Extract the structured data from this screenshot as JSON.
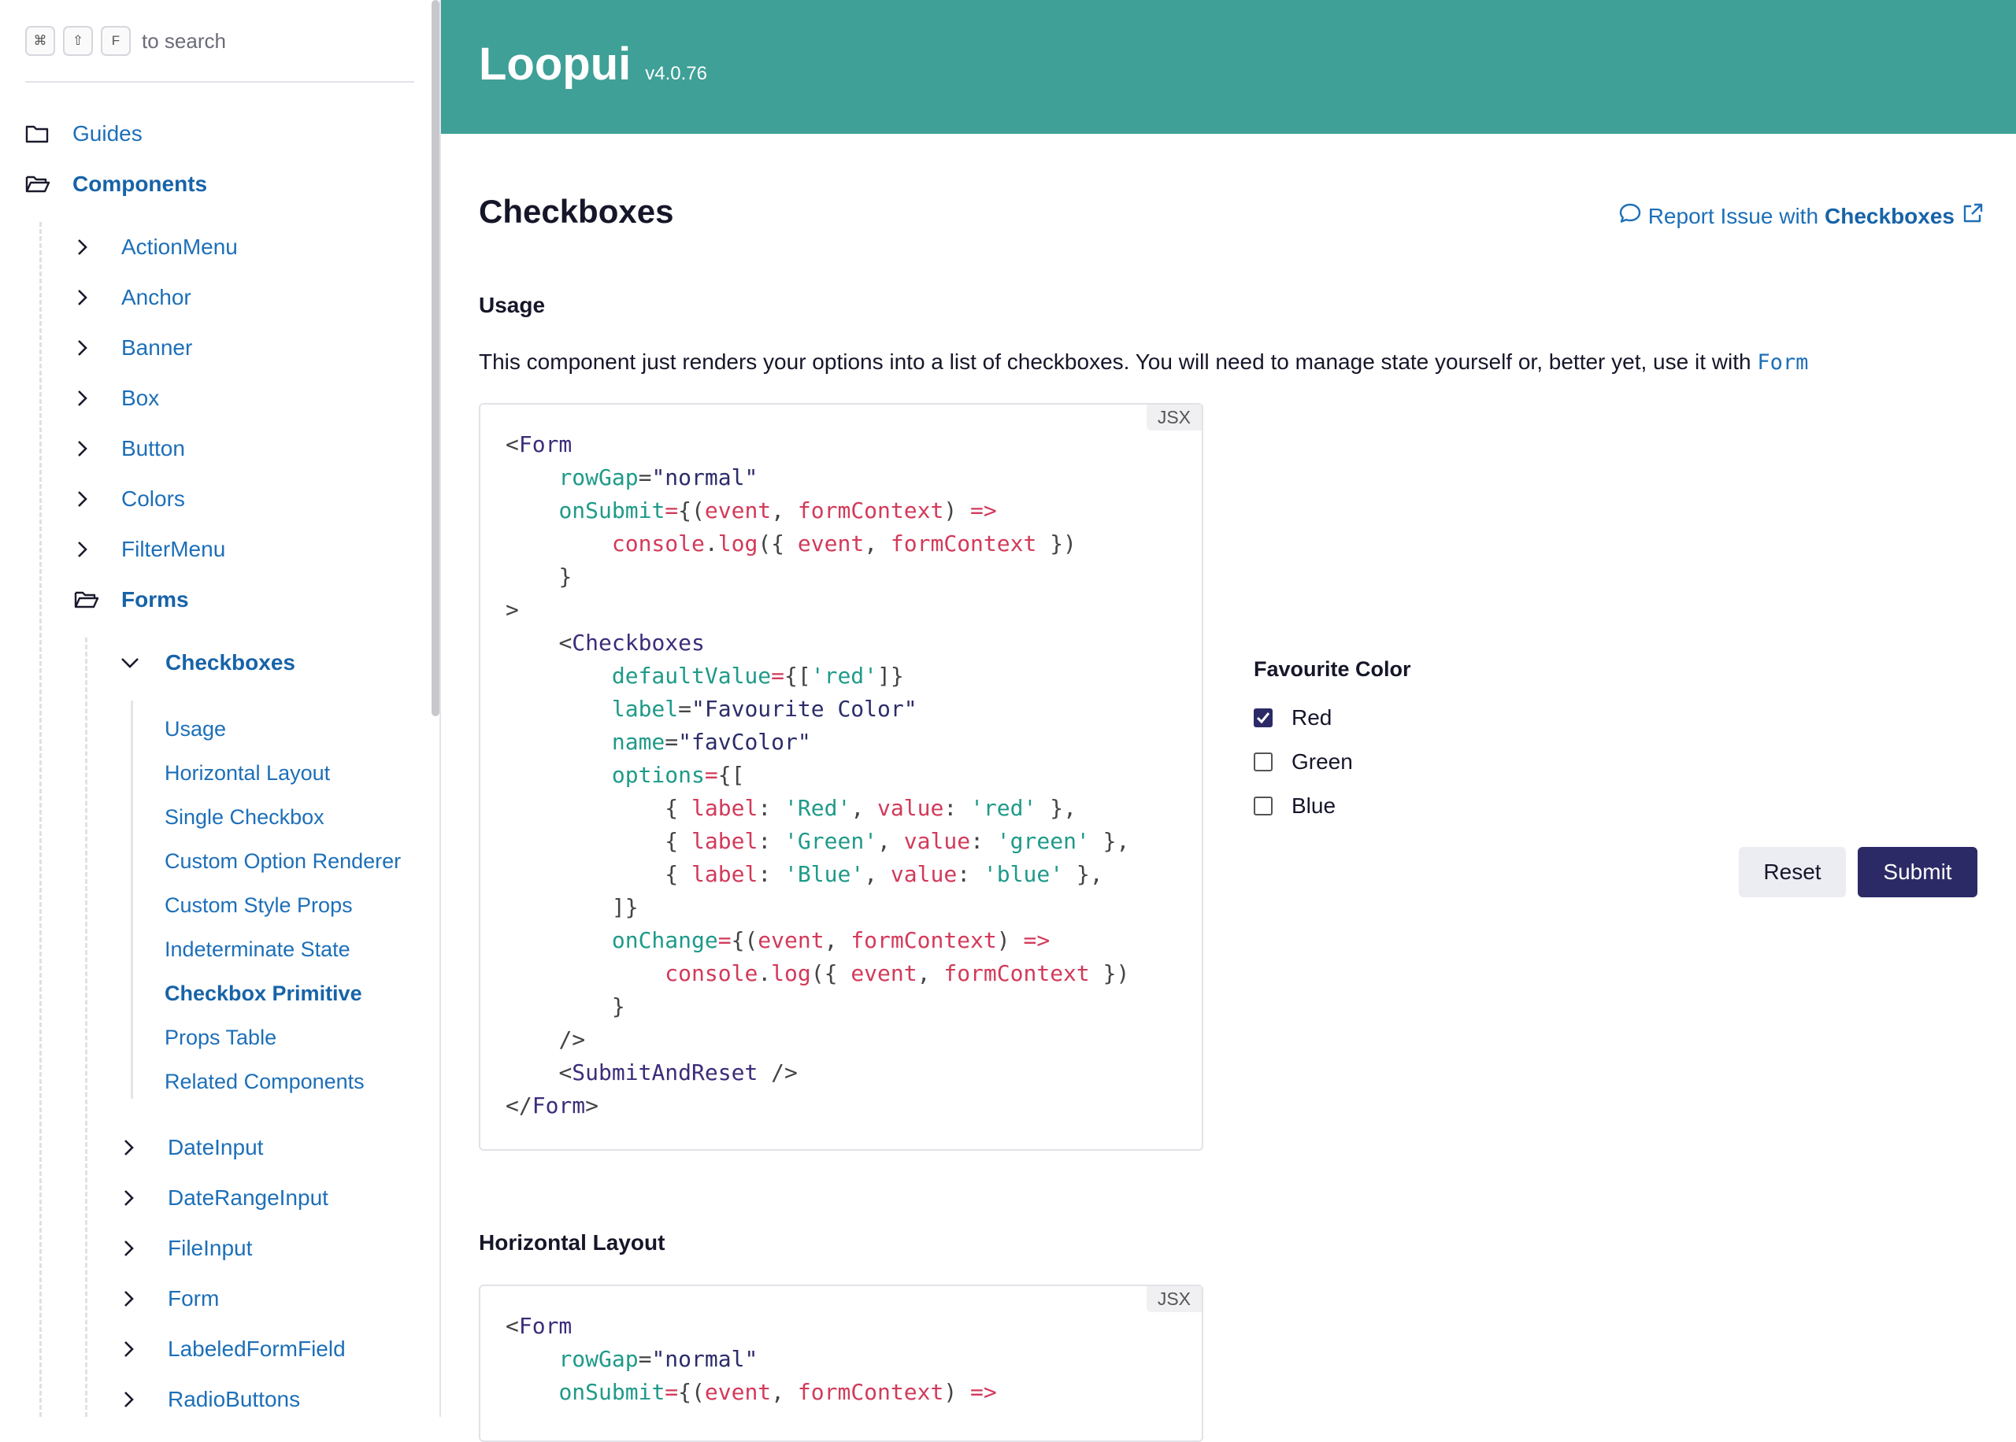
{
  "search": {
    "keys": [
      "⌘",
      "⇧",
      "F"
    ],
    "text": "to search"
  },
  "sidebar": {
    "top_items": [
      {
        "label": "Guides",
        "icon": "folder-icon"
      },
      {
        "label": "Components",
        "icon": "folder-open-icon"
      }
    ],
    "components": [
      "ActionMenu",
      "Anchor",
      "Banner",
      "Box",
      "Button",
      "Colors",
      "FilterMenu"
    ],
    "forms_label": "Forms",
    "checkboxes_label": "Checkboxes",
    "checkboxes_sections": [
      "Usage",
      "Horizontal Layout",
      "Single Checkbox",
      "Custom Option Renderer",
      "Custom Style Props",
      "Indeterminate State",
      "Checkbox Primitive",
      "Props Table",
      "Related Components"
    ],
    "forms_children": [
      "DateInput",
      "DateRangeInput",
      "FileInput",
      "Form",
      "LabeledFormField",
      "RadioButtons"
    ]
  },
  "header": {
    "brand": "Loopui",
    "version": "v4.0.76"
  },
  "page": {
    "title": "Checkboxes",
    "report_prefix": "Report Issue with",
    "report_name": "Checkboxes"
  },
  "usage": {
    "title": "Usage",
    "description": "This component just renders your options into a list of checkboxes. You will need to manage state yourself or, better yet, use it with",
    "description_code": "Form",
    "code_lang": "JSX"
  },
  "demo": {
    "legend": "Favourite Color",
    "options": [
      {
        "label": "Red",
        "checked": true
      },
      {
        "label": "Green",
        "checked": false
      },
      {
        "label": "Blue",
        "checked": false
      }
    ],
    "reset_label": "Reset",
    "submit_label": "Submit"
  },
  "horizontal": {
    "title": "Horizontal Layout",
    "code_lang": "JSX"
  },
  "colors": {
    "header": "#3ea097",
    "link": "#1d6fb8",
    "primary": "#2c2a66"
  }
}
